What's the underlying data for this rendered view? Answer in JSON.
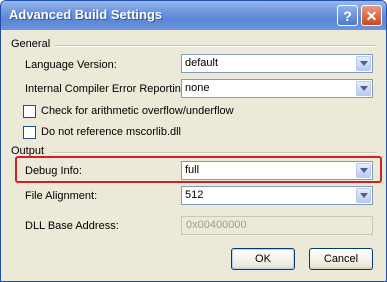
{
  "window": {
    "title": "Advanced Build Settings",
    "help_label": "?",
    "close_label": "✕"
  },
  "general": {
    "heading": "General",
    "language_version": {
      "label": "Language Version:",
      "value": "default"
    },
    "compiler_error_reporting": {
      "label": "Internal Compiler Error Reporting:",
      "value": "none"
    },
    "check_overflow": {
      "label": "Check for arithmetic overflow/underflow",
      "checked": false
    },
    "no_mscorlib": {
      "label": "Do not reference mscorlib.dll",
      "checked": false
    }
  },
  "output": {
    "heading": "Output",
    "debug_info": {
      "label": "Debug Info:",
      "value": "full"
    },
    "file_alignment": {
      "label": "File Alignment:",
      "value": "512"
    },
    "dll_base_address": {
      "label": "DLL Base Address:",
      "value": "0x00400000"
    }
  },
  "buttons": {
    "ok": "OK",
    "cancel": "Cancel"
  },
  "colors": {
    "title_bar": "#5a86d6",
    "highlight_border": "#d01f25",
    "dialog_bg": "#ece9d8"
  }
}
